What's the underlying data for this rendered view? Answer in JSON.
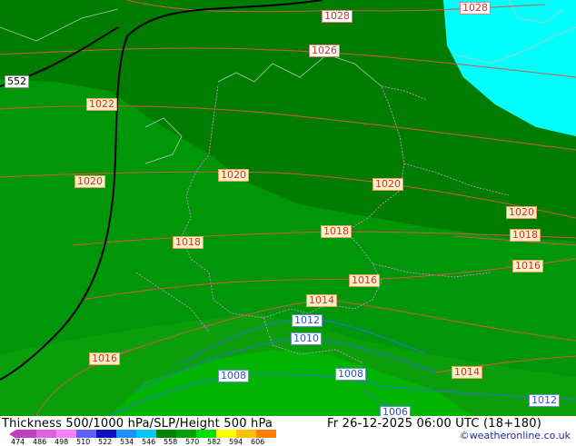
{
  "map": {
    "isobar_labels_red": [
      "1028",
      "1028",
      "1026",
      "1022",
      "1020",
      "1020",
      "1020",
      "1020",
      "1018",
      "1018",
      "1018",
      "1016",
      "1016",
      "1014",
      "1014",
      "1016"
    ],
    "isobar_labels_blue": [
      "1012",
      "1010",
      "1008",
      "1008",
      "1006",
      "1012"
    ],
    "height_label": "552",
    "colors": {
      "dark_green": "#007d00",
      "mid_green": "#00960a",
      "light_green": "#16aa16",
      "bright_green": "#00b400",
      "cyan": "#00ffff",
      "isobar": "#d05a4a",
      "isobar_low": "#2f6fd6"
    }
  },
  "footer": {
    "title": "Thickness 500/1000 hPa/SLP/Height 500 hPa",
    "date": "Fr 26-12-2025 06:00 UTC (18+180)",
    "credit": "©weatheronline.co.uk",
    "scale_ticks": [
      "474",
      "486",
      "498",
      "510",
      "522",
      "534",
      "546",
      "558",
      "570",
      "582",
      "594",
      "606"
    ],
    "scale_colors": [
      "#c040c0",
      "#e060e0",
      "#ff80ff",
      "#6060ff",
      "#1010c0",
      "#2090ff",
      "#00c8ff",
      "#008000",
      "#00a000",
      "#00e000",
      "#ffff00",
      "#ffc000",
      "#ff8000"
    ]
  }
}
